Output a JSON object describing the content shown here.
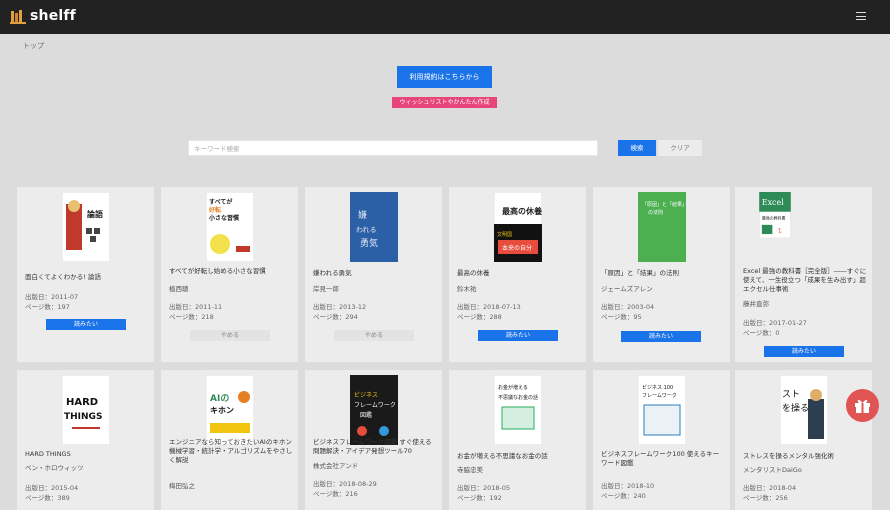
{
  "header": {
    "app_name": "shelff"
  },
  "breadcrumb": "トップ",
  "help_button": "利用規約はこちらから",
  "wishlist_button": "ウィッシュリストやかんたん作成",
  "search": {
    "placeholder": "キーワード検索",
    "search_label": "検索",
    "clear_label": "クリア"
  },
  "books": [
    {
      "title": "面白くてよくわかる! 論語",
      "author": "",
      "date": "出版日：2011-07",
      "pages": "ページ数：197",
      "action": "読みたい",
      "action_style": "want",
      "cover_label": "論語",
      "cover_color": "#ffffff"
    },
    {
      "title": "すべてが好転し始める小さな習慣",
      "author": "植西聰",
      "date": "出版日：2011-11",
      "pages": "ページ数：218",
      "action": "やめる",
      "action_style": "stop",
      "cover_label": "すべてが好転し始める小さな習慣",
      "cover_color": "#ffffff"
    },
    {
      "title": "嫌われる勇気",
      "author": "岸見一郎",
      "date": "出版日：2013-12",
      "pages": "ページ数：294",
      "action": "やめる",
      "action_style": "stop",
      "cover_label": "嫌われる勇気",
      "cover_color": "#2b5fa6"
    },
    {
      "title": "最高の休養",
      "author": "鈴木祐",
      "date": "出版日：2018-07-13",
      "pages": "ページ数：288",
      "action": "読みたい",
      "action_style": "want",
      "cover_label": "最高の休養",
      "cover_color": "#ffffff"
    },
    {
      "title": "「原因」と「結果」の法則",
      "author": "ジェームズアレン",
      "date": "出版日：2003-04",
      "pages": "ページ数：95",
      "action": "読みたい",
      "action_style": "want",
      "cover_label": "「原因」と「結果」の法則",
      "cover_color": "#4caf50"
    },
    {
      "title": "Excel 最強の教科書［完全版］――すぐに使えて、一生役立つ「成果を生み出す」超エクセル仕事術",
      "author": "藤井直弥",
      "date": "出版日：2017-01-27",
      "pages": "ページ数：0",
      "action": "読みたい",
      "action_style": "want",
      "cover_label": "Excel 最強の教科書",
      "cover_color": "#2e8b57"
    },
    {
      "title": "HARD THINGS",
      "author": "ベン・ホロウィッツ",
      "date": "出版日：2015-04",
      "pages": "ページ数：389",
      "action": "",
      "action_style": "",
      "cover_label": "HARD THINGS",
      "cover_color": "#ffffff"
    },
    {
      "title": "エンジニアなら知っておきたいAIのキホン 機械学習・統計学・アルゴリズムをやさしく解説",
      "author": "梅田弘之",
      "date": "",
      "pages": "",
      "action": "",
      "action_style": "",
      "cover_label": "AIのキホン",
      "cover_color": "#ffffff"
    },
    {
      "title": "ビジネスフレームワーク図鑑 すぐ使える問題解決・アイデア発想ツール70",
      "author": "株式会社アンド",
      "date": "出版日：2018-08-29",
      "pages": "ページ数：216",
      "action": "",
      "action_style": "",
      "cover_label": "ビジネスフレームワーク図鑑",
      "cover_color": "#1a1a1a"
    },
    {
      "title": "お金が増える不思議なお金の話",
      "author": "寺脇忠美",
      "date": "出版日：2018-05",
      "pages": "ページ数：192",
      "action": "",
      "action_style": "",
      "cover_label": "お金が増える不思議なお金の話",
      "cover_color": "#ffffff"
    },
    {
      "title": "ビジネスフレームワーク100 使えるキーワード図鑑",
      "author": "",
      "date": "出版日：2018-10",
      "pages": "ページ数：240",
      "action": "",
      "action_style": "",
      "cover_label": "ビジネス100フレームワーク",
      "cover_color": "#ffffff"
    },
    {
      "title": "ストレスを操るメンタル強化術",
      "author": "メンタリストDaiGo",
      "date": "出版日：2018-04",
      "pages": "ページ数：256",
      "action": "",
      "action_style": "",
      "cover_label": "ストレスを操る",
      "cover_color": "#ffffff"
    }
  ],
  "colors": {
    "header_bg": "#222222",
    "accent_blue": "#1a73e8",
    "wishlist_pink": "#e8457a",
    "gift_red": "#e15454"
  }
}
